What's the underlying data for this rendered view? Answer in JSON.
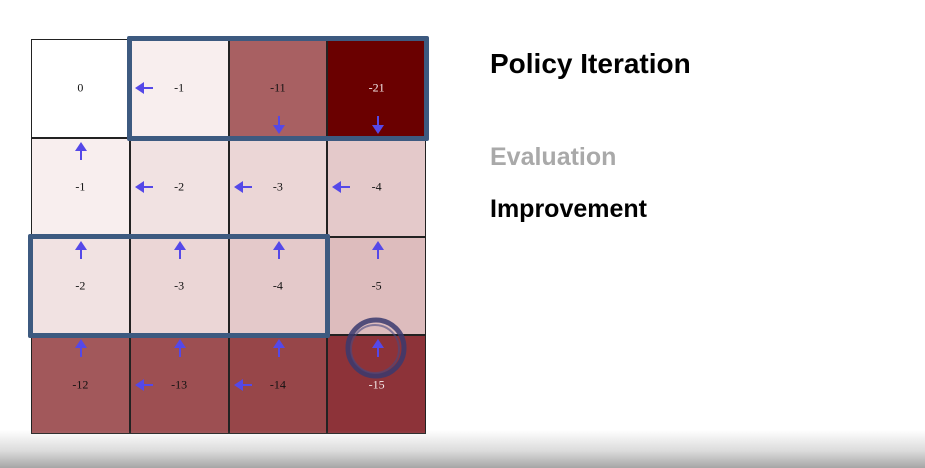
{
  "slide": {
    "title": "Policy Iteration",
    "steps": [
      {
        "label": "Evaluation",
        "active": false
      },
      {
        "label": "Improvement",
        "active": true
      }
    ]
  },
  "gridworld": {
    "rows": 4,
    "cols": 4,
    "arrow_color": "#5548e8",
    "highlight_color": "#3d5a80",
    "cells": [
      {
        "row": 0,
        "col": 0,
        "value": "0",
        "bg": "#ffffff",
        "light_text": false,
        "arrows": []
      },
      {
        "row": 0,
        "col": 1,
        "value": "-1",
        "bg": "#f8eeee",
        "light_text": false,
        "arrows": [
          "left"
        ]
      },
      {
        "row": 0,
        "col": 2,
        "value": "-11",
        "bg": "#a86062",
        "light_text": false,
        "arrows": [
          "down"
        ]
      },
      {
        "row": 0,
        "col": 3,
        "value": "-21",
        "bg": "#6a0000",
        "light_text": true,
        "arrows": [
          "down"
        ]
      },
      {
        "row": 1,
        "col": 0,
        "value": "-1",
        "bg": "#f8eeee",
        "light_text": false,
        "arrows": [
          "up"
        ]
      },
      {
        "row": 1,
        "col": 1,
        "value": "-2",
        "bg": "#f1e2e2",
        "light_text": false,
        "arrows": [
          "left"
        ]
      },
      {
        "row": 1,
        "col": 2,
        "value": "-3",
        "bg": "#ebd6d6",
        "light_text": false,
        "arrows": [
          "left"
        ]
      },
      {
        "row": 1,
        "col": 3,
        "value": "-4",
        "bg": "#e4c9ca",
        "light_text": false,
        "arrows": [
          "left"
        ]
      },
      {
        "row": 2,
        "col": 0,
        "value": "-2",
        "bg": "#f1e2e2",
        "light_text": false,
        "arrows": [
          "up"
        ]
      },
      {
        "row": 2,
        "col": 1,
        "value": "-3",
        "bg": "#ebd6d6",
        "light_text": false,
        "arrows": [
          "up"
        ]
      },
      {
        "row": 2,
        "col": 2,
        "value": "-4",
        "bg": "#e4c9ca",
        "light_text": false,
        "arrows": [
          "up"
        ]
      },
      {
        "row": 2,
        "col": 3,
        "value": "-5",
        "bg": "#ddbcbd",
        "light_text": false,
        "arrows": [
          "up"
        ]
      },
      {
        "row": 3,
        "col": 0,
        "value": "-12",
        "bg": "#a2585b",
        "light_text": false,
        "arrows": [
          "up"
        ]
      },
      {
        "row": 3,
        "col": 1,
        "value": "-13",
        "bg": "#9d4f52",
        "light_text": false,
        "arrows": [
          "up",
          "left"
        ]
      },
      {
        "row": 3,
        "col": 2,
        "value": "-14",
        "bg": "#974649",
        "light_text": false,
        "arrows": [
          "up",
          "left"
        ]
      },
      {
        "row": 3,
        "col": 3,
        "value": "-15",
        "bg": "#8d3339",
        "light_text": true,
        "arrows": [
          "up"
        ]
      }
    ],
    "highlights": [
      {
        "row": 0,
        "col": 1,
        "row_span": 1,
        "col_span": 3
      },
      {
        "row": 2,
        "col": 0,
        "row_span": 1,
        "col_span": 3
      }
    ],
    "circled_cell": {
      "row": 3,
      "col": 3
    }
  }
}
